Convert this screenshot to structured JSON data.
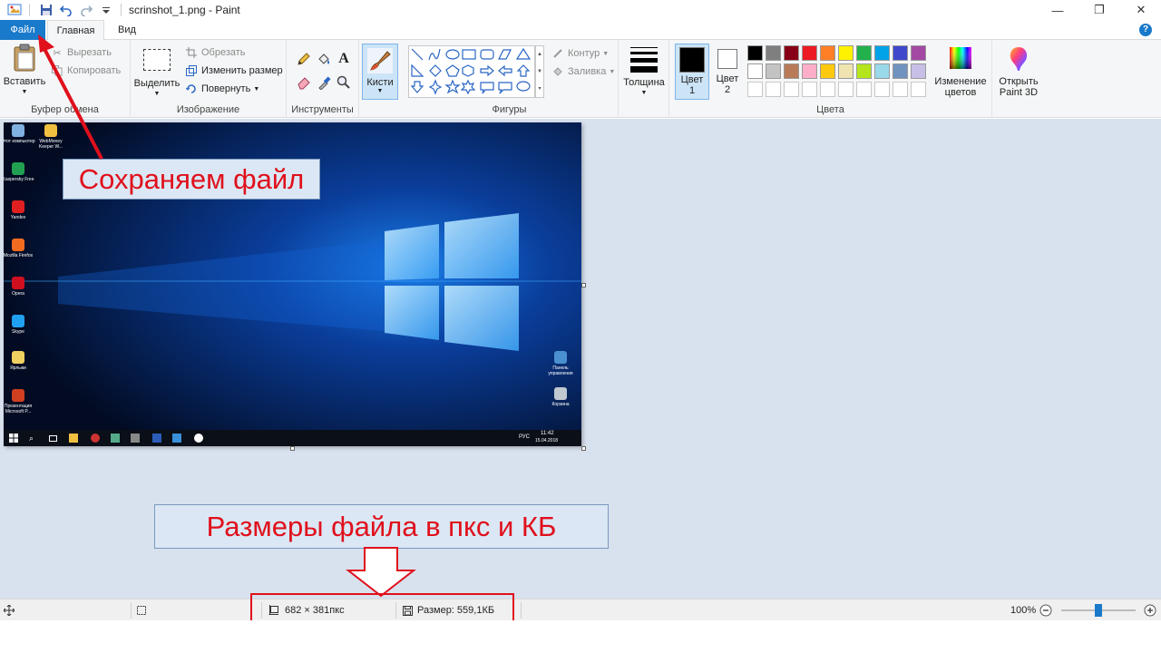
{
  "window": {
    "title": "scrinshot_1.png - Paint",
    "minimize_label": "—",
    "restore_label": "❐",
    "close_label": "✕"
  },
  "tabs": {
    "file": "Файл",
    "home": "Главная",
    "view": "Вид",
    "help": "?"
  },
  "clipboard": {
    "paste": "Вставить",
    "cut": "Вырезать",
    "copy": "Копировать",
    "group_label": "Буфер обмена"
  },
  "image": {
    "select": "Выделить",
    "crop": "Обрезать",
    "resize": "Изменить размер",
    "rotate": "Повернуть",
    "group_label": "Изображение"
  },
  "tools": {
    "group_label": "Инструменты"
  },
  "brushes": {
    "label": "Кисти"
  },
  "shapes": {
    "outline": "Контур",
    "fill": "Заливка",
    "group_label": "Фигуры"
  },
  "size": {
    "label": "Толщина"
  },
  "colors": {
    "color1_line1": "Цвет",
    "color1_line2": "1",
    "color2_line1": "Цвет",
    "color2_line2": "2",
    "edit_line1": "Изменение",
    "edit_line2": "цветов",
    "group_label": "Цвета",
    "color1": "#000000",
    "color2": "#ffffff",
    "palette_row1": [
      "#000000",
      "#7f7f7f",
      "#880015",
      "#ed1c24",
      "#ff7f27",
      "#fff200",
      "#22b14c",
      "#00a2e8",
      "#3f48cc",
      "#a349a4"
    ],
    "palette_row2": [
      "#ffffff",
      "#c3c3c3",
      "#b97a57",
      "#ffaec9",
      "#ffc90e",
      "#efe4b0",
      "#b5e61d",
      "#99d9ea",
      "#7092be",
      "#c8bfe7"
    ]
  },
  "paint3d": {
    "line1": "Открыть",
    "line2": "Paint 3D"
  },
  "desktop": {
    "icons": [
      {
        "label": "Этот компьютер"
      },
      {
        "label": "WebMoney Keeper W..."
      },
      {
        "label": "Kaspersky Free"
      },
      {
        "label": "Yandex"
      },
      {
        "label": "Mozilla Firefox"
      },
      {
        "label": "Opera"
      },
      {
        "label": "Skype"
      },
      {
        "label": "Ярлыки"
      },
      {
        "label": "Презентация Microsoft P..."
      }
    ],
    "right_icons": [
      {
        "label": "Панель управления"
      },
      {
        "label": "Корзина"
      }
    ],
    "tray_lang": "РУС",
    "tray_time": "11:42",
    "tray_date": "15.04.2018"
  },
  "callouts": {
    "save": "Сохраняем файл",
    "size": "Размеры файла в пкс и КБ"
  },
  "status": {
    "dimensions": "682 × 381пкс",
    "filesize": "Размер: 559,1КБ",
    "zoom": "100%",
    "zoom_fraction": 0.5
  }
}
